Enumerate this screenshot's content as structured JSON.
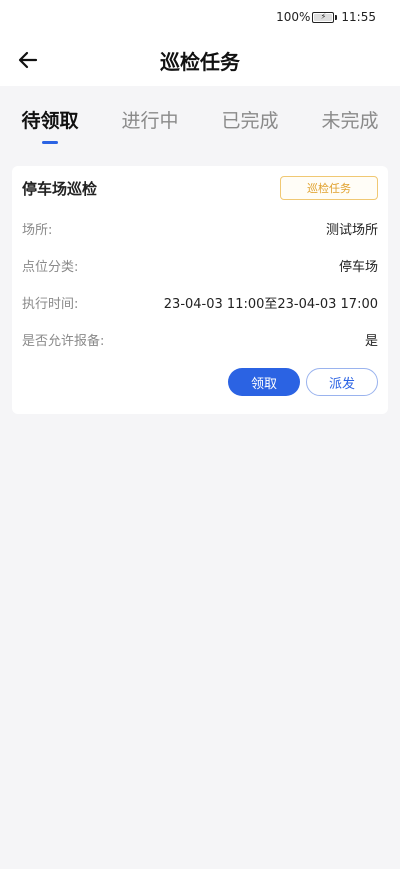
{
  "status": {
    "battery": "100%",
    "time": "11:55"
  },
  "header": {
    "title": "巡检任务"
  },
  "tabs": [
    {
      "label": "待领取",
      "active": true
    },
    {
      "label": "进行中",
      "active": false
    },
    {
      "label": "已完成",
      "active": false
    },
    {
      "label": "未完成",
      "active": false
    }
  ],
  "task": {
    "name": "停车场巡检",
    "badge": "巡检任务",
    "fields": [
      {
        "label": "场所:",
        "value": "测试场所"
      },
      {
        "label": "点位分类:",
        "value": "停车场"
      },
      {
        "label": "执行时间:",
        "value": "23-04-03 11:00至23-04-03 17:00"
      },
      {
        "label": "是否允许报备:",
        "value": "是"
      }
    ],
    "claim_label": "领取",
    "dispatch_label": "派发"
  },
  "colors": {
    "accent": "#2b63e3",
    "badge": "#e0a12d",
    "background": "#f5f5f7"
  }
}
